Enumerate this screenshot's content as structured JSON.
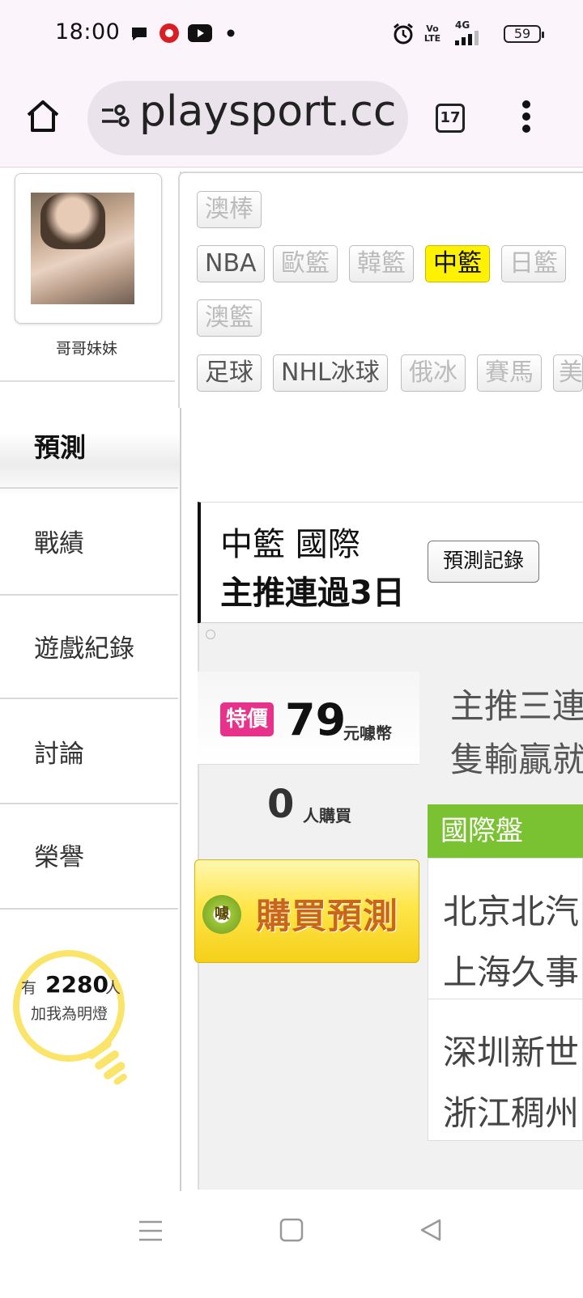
{
  "status_bar": {
    "time": "18:00",
    "battery": "59",
    "network": "4G",
    "volte": "Vo LTE",
    "icons": [
      "chat-bubble-icon",
      "app-badge-icon",
      "youtube-icon",
      "dot-icon",
      "alarm-icon",
      "volte-icon",
      "signal-icon",
      "battery-icon"
    ]
  },
  "browser": {
    "url": "playsport.cc",
    "tab_count": "17",
    "icons": [
      "home-icon",
      "site-settings-icon",
      "tab-switcher-icon",
      "more-vert-icon"
    ]
  },
  "profile": {
    "username": "哥哥妹妹"
  },
  "sidebar": {
    "items": [
      {
        "label": "預測",
        "active": true
      },
      {
        "label": "戰績"
      },
      {
        "label": "遊戲紀錄"
      },
      {
        "label": "討論"
      },
      {
        "label": "榮譽"
      }
    ]
  },
  "fans": {
    "prefix": "有",
    "count": "2280",
    "suffix": "人",
    "line2": "加我為明燈"
  },
  "sports": {
    "row1": [
      {
        "label": "澳棒",
        "state": "dim"
      }
    ],
    "row2": [
      {
        "label": "NBA",
        "state": "normal"
      },
      {
        "label": "歐籃",
        "state": "dim"
      },
      {
        "label": "韓籃",
        "state": "dim"
      },
      {
        "label": "中籃",
        "state": "active"
      },
      {
        "label": "日籃",
        "state": "dim"
      }
    ],
    "row3": [
      {
        "label": "澳籃",
        "state": "dim"
      }
    ],
    "row4": [
      {
        "label": "足球",
        "state": "normal"
      },
      {
        "label": "NHL冰球",
        "state": "normal"
      },
      {
        "label": "俄冰",
        "state": "dim"
      },
      {
        "label": "賽馬",
        "state": "dim"
      },
      {
        "label": "美",
        "state": "dim"
      }
    ]
  },
  "prediction": {
    "title_line1": "中籃 國際",
    "title_line2": "主推連過3日",
    "record_button": "預測記錄",
    "special_badge": "特價",
    "price": "79",
    "price_unit": "元噱幣",
    "buyers": "0",
    "buyers_unit": "人購買",
    "buy_icon_text": "噱",
    "buy_button": "購買預測",
    "desc_line1": "主推三連",
    "desc_line2": "隻輸贏就",
    "market_header": "國際盤",
    "games": [
      {
        "team1": "北京北汽",
        "team2": "上海久事"
      },
      {
        "team1": "深圳新世",
        "team2": "浙江稠州"
      }
    ]
  },
  "nav_bar": {
    "icons": [
      "menu-icon",
      "home-square-icon",
      "back-triangle-icon"
    ]
  },
  "colors": {
    "active_tag": "#fff200",
    "special_badge": "#e8318a",
    "market_header": "#7ac231",
    "bulb": "#fbe46a"
  }
}
